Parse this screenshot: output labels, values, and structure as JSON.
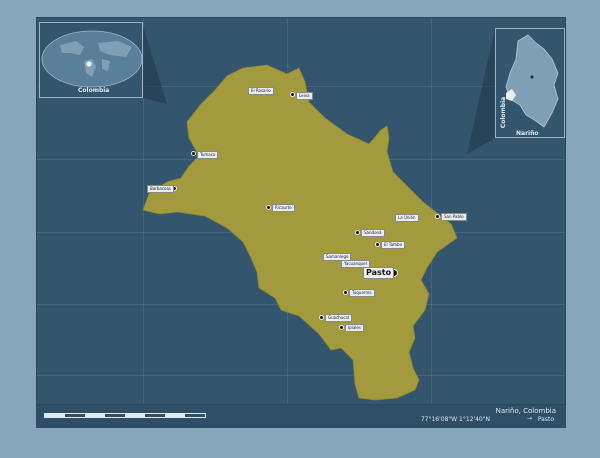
{
  "title": "Nariño, Colombia",
  "coordinates": "77°16'08\"W  1°12'40\"N",
  "capital_legend": "Pasto",
  "capital": {
    "name": "Pasto"
  },
  "inset_world": {
    "label": "Colombia"
  },
  "inset_country": {
    "label": "Nariño",
    "country_label": "Colombia"
  },
  "cities": [
    {
      "name": "El Rosario"
    },
    {
      "name": "Leiva"
    },
    {
      "name": "Tumaco"
    },
    {
      "name": "Barbacoas"
    },
    {
      "name": "Ricaurte"
    },
    {
      "name": "La Unión"
    },
    {
      "name": "San Pablo"
    },
    {
      "name": "Sandoná"
    },
    {
      "name": "El Tambo"
    },
    {
      "name": "Samaniego"
    },
    {
      "name": "Yacuanquer"
    },
    {
      "name": "Túquerres"
    },
    {
      "name": "Guachucal"
    },
    {
      "name": "Ipiales"
    },
    {
      "name": "Cumbitara"
    }
  ],
  "colors": {
    "region_fill": "#a39a3e",
    "water": "#34556e",
    "frame": "#88a6bb"
  }
}
